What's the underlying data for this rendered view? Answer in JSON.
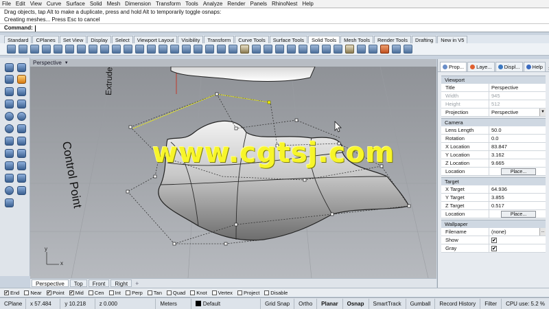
{
  "menu": [
    "File",
    "Edit",
    "View",
    "Curve",
    "Surface",
    "Solid",
    "Mesh",
    "Dimension",
    "Transform",
    "Tools",
    "Analyze",
    "Render",
    "Panels",
    "RhinoNest",
    "Help"
  ],
  "command_history": [
    "Drag objects, tap Alt to make a duplicate, press and hold Alt to temporarily toggle osnaps:",
    "Creating meshes... Press Esc to cancel"
  ],
  "command_label": "Command:",
  "command_value": "",
  "toolbar_tabs": [
    "Standard",
    "CPlanes",
    "Set View",
    "Display",
    "Select",
    "Viewport Layout",
    "Visibility",
    "Transform",
    "Curve Tools",
    "Surface Tools",
    "Solid Tools",
    "Mesh Tools",
    "Render Tools",
    "Drafting",
    "New in V5"
  ],
  "active_toolbar_tab": "Solid Tools",
  "viewport": {
    "name": "Perspective",
    "dropdown_glyph": "▼",
    "label_top": "Extrude surface",
    "label_side": "Control Point",
    "axis_x": "x",
    "axis_y": "y"
  },
  "watermark": "www.cgtsj.com",
  "viewport_tabs": [
    "Perspective",
    "Top",
    "Front",
    "Right"
  ],
  "active_viewport_tab": "Perspective",
  "viewport_tab_add": "+",
  "panel_tabs": [
    {
      "label": "Prop...",
      "icon": "properties-icon"
    },
    {
      "label": "Laye...",
      "icon": "layers-icon"
    },
    {
      "label": "Displ...",
      "icon": "display-icon"
    },
    {
      "label": "Help",
      "icon": "help-icon"
    }
  ],
  "panel_more": "»",
  "properties": {
    "viewport_section": "Viewport",
    "title_label": "Title",
    "title_value": "Perspective",
    "width_label": "Width",
    "width_value": "945",
    "height_label": "Height",
    "height_value": "512",
    "projection_label": "Projection",
    "projection_value": "Perspective",
    "camera_section": "Camera",
    "lens_label": "Lens Length",
    "lens_value": "50.0",
    "rotation_label": "Rotation",
    "rotation_value": "0.0",
    "xloc_label": "X Location",
    "xloc_value": "83.847",
    "yloc_label": "Y Location",
    "yloc_value": "3.162",
    "zloc_label": "Z Location",
    "zloc_value": "9.665",
    "location_label": "Location",
    "place_label": "Place...",
    "target_section": "Target",
    "xt_label": "X Target",
    "xt_value": "64.936",
    "yt_label": "Y Target",
    "yt_value": "3.855",
    "zt_label": "Z Target",
    "zt_value": "0.517",
    "tlocation_label": "Location",
    "tplace_label": "Place...",
    "wallpaper_section": "Wallpaper",
    "filename_label": "Filename",
    "filename_value": "(none)",
    "filename_btn": "...",
    "show_label": "Show",
    "show_checked": "✔",
    "gray_label": "Gray",
    "gray_checked": "✔"
  },
  "osnaps": [
    {
      "label": "End",
      "checked": "✔"
    },
    {
      "label": "Near",
      "checked": ""
    },
    {
      "label": "Point",
      "checked": "✔"
    },
    {
      "label": "Mid",
      "checked": "✔"
    },
    {
      "label": "Cen",
      "checked": ""
    },
    {
      "label": "Int",
      "checked": ""
    },
    {
      "label": "Perp",
      "checked": ""
    },
    {
      "label": "Tan",
      "checked": ""
    },
    {
      "label": "Quad",
      "checked": ""
    },
    {
      "label": "Knot",
      "checked": ""
    },
    {
      "label": "Vertex",
      "checked": ""
    },
    {
      "label": "Project",
      "checked": ""
    },
    {
      "label": "Disable",
      "checked": ""
    }
  ],
  "status": {
    "cplane": "CPlane",
    "x": "x 57.484",
    "y": "y 10.218",
    "z": "z 0.000",
    "units": "Meters",
    "layer": "Default",
    "grid_snap": "Grid Snap",
    "ortho": "Ortho",
    "planar": "Planar",
    "osnap": "Osnap",
    "smarttrack": "SmartTrack",
    "gumball": "Gumball",
    "record_history": "Record History",
    "filter": "Filter",
    "cpu": "CPU use: 5.2 %"
  }
}
